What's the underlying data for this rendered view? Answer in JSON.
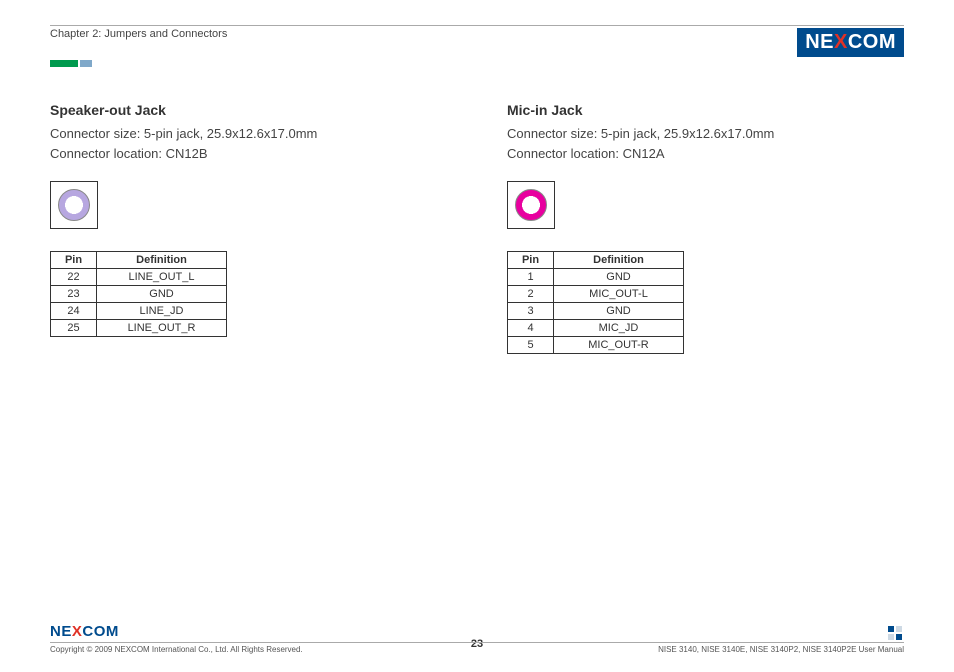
{
  "header": {
    "chapter": "Chapter 2: Jumpers and Connectors"
  },
  "logo": {
    "text_left": "NE",
    "text_x": "X",
    "text_right": "COM"
  },
  "left": {
    "title": "Speaker-out Jack",
    "size": "Connector size: 5-pin jack, 25.9x12.6x17.0mm",
    "loc": "Connector location: CN12B",
    "cols": {
      "pin": "Pin",
      "def": "Definition"
    },
    "rows": [
      {
        "pin": "22",
        "def": "LINE_OUT_L"
      },
      {
        "pin": "23",
        "def": "GND"
      },
      {
        "pin": "24",
        "def": "LINE_JD"
      },
      {
        "pin": "25",
        "def": "LINE_OUT_R"
      }
    ]
  },
  "right": {
    "title": "Mic-in Jack",
    "size": "Connector size: 5-pin jack, 25.9x12.6x17.0mm",
    "loc": "Connector location: CN12A",
    "cols": {
      "pin": "Pin",
      "def": "Definition"
    },
    "rows": [
      {
        "pin": "1",
        "def": "GND"
      },
      {
        "pin": "2",
        "def": "MIC_OUT-L"
      },
      {
        "pin": "3",
        "def": "GND"
      },
      {
        "pin": "4",
        "def": "MIC_JD"
      },
      {
        "pin": "5",
        "def": "MIC_OUT-R"
      }
    ]
  },
  "footer": {
    "copyright": "Copyright © 2009 NEXCOM International Co., Ltd. All Rights Reserved.",
    "page": "23",
    "manual": "NISE 3140, NISE 3140E, NISE 3140P2, NISE 3140P2E User Manual"
  }
}
